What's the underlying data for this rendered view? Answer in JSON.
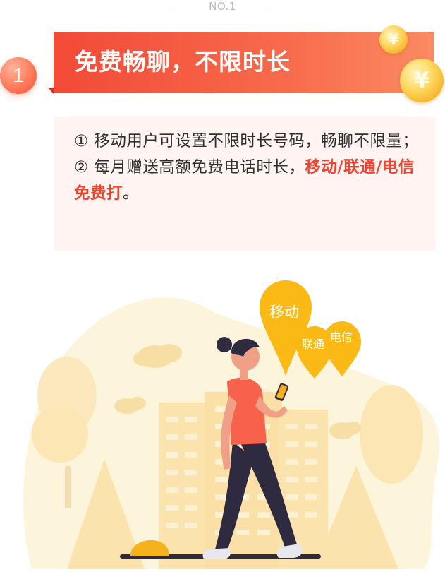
{
  "header": {
    "section_number": "NO.1"
  },
  "step": {
    "number": "1"
  },
  "banner": {
    "title": "免费畅聊，不限时长"
  },
  "coins": {
    "symbol": "¥"
  },
  "info": {
    "line1_prefix": "①",
    "line1_text": "移动用户可设置不限时长号码，畅聊不限量；",
    "line2_prefix": "②",
    "line2_text": "每月赠送高额免费电话时长，",
    "line2_highlight": "移动/联通/电信免费打",
    "line2_suffix": "。"
  },
  "pins": [
    {
      "label": "移动"
    },
    {
      "label": "联通"
    },
    {
      "label": "电信"
    }
  ],
  "colors": {
    "accent_red": "#f24a37",
    "highlight_red": "#f0432f",
    "pin_yellow": "#fbb915",
    "info_bg": "#fff4f2"
  }
}
